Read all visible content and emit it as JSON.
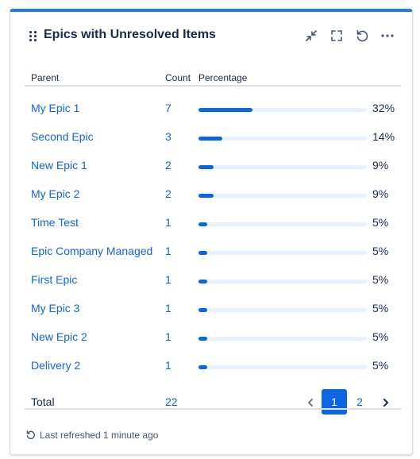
{
  "gadget": {
    "title": "Epics with Unresolved Items",
    "accent_color": "#1d7afc",
    "icons": [
      "drag-handle-icon",
      "minimize-icon",
      "fullscreen-icon",
      "refresh-icon",
      "more-icon"
    ]
  },
  "table": {
    "columns": {
      "parent": "Parent",
      "count": "Count",
      "percentage": "Percentage"
    },
    "rows": [
      {
        "parent": "My Epic 1",
        "count": "7",
        "percent": 32,
        "percent_label": "32%"
      },
      {
        "parent": "Second Epic",
        "count": "3",
        "percent": 14,
        "percent_label": "14%"
      },
      {
        "parent": "New Epic 1",
        "count": "2",
        "percent": 9,
        "percent_label": "9%"
      },
      {
        "parent": "My Epic 2",
        "count": "2",
        "percent": 9,
        "percent_label": "9%"
      },
      {
        "parent": "Time Test",
        "count": "1",
        "percent": 5,
        "percent_label": "5%"
      },
      {
        "parent": "Epic Company Managed",
        "count": "1",
        "percent": 5,
        "percent_label": "5%"
      },
      {
        "parent": "First Epic",
        "count": "1",
        "percent": 5,
        "percent_label": "5%"
      },
      {
        "parent": "My Epic 3",
        "count": "1",
        "percent": 5,
        "percent_label": "5%"
      },
      {
        "parent": "New Epic 2",
        "count": "1",
        "percent": 5,
        "percent_label": "5%"
      },
      {
        "parent": "Delivery 2",
        "count": "1",
        "percent": 5,
        "percent_label": "5%"
      }
    ],
    "total": {
      "label": "Total",
      "count": "22"
    },
    "bar_colors": {
      "fill": "#0c66e4",
      "track": "#e9f2ff"
    }
  },
  "pagination": {
    "pages": [
      "1",
      "2"
    ],
    "current_page": "1"
  },
  "footer": {
    "last_refreshed": "Last refreshed 1 minute ago"
  }
}
